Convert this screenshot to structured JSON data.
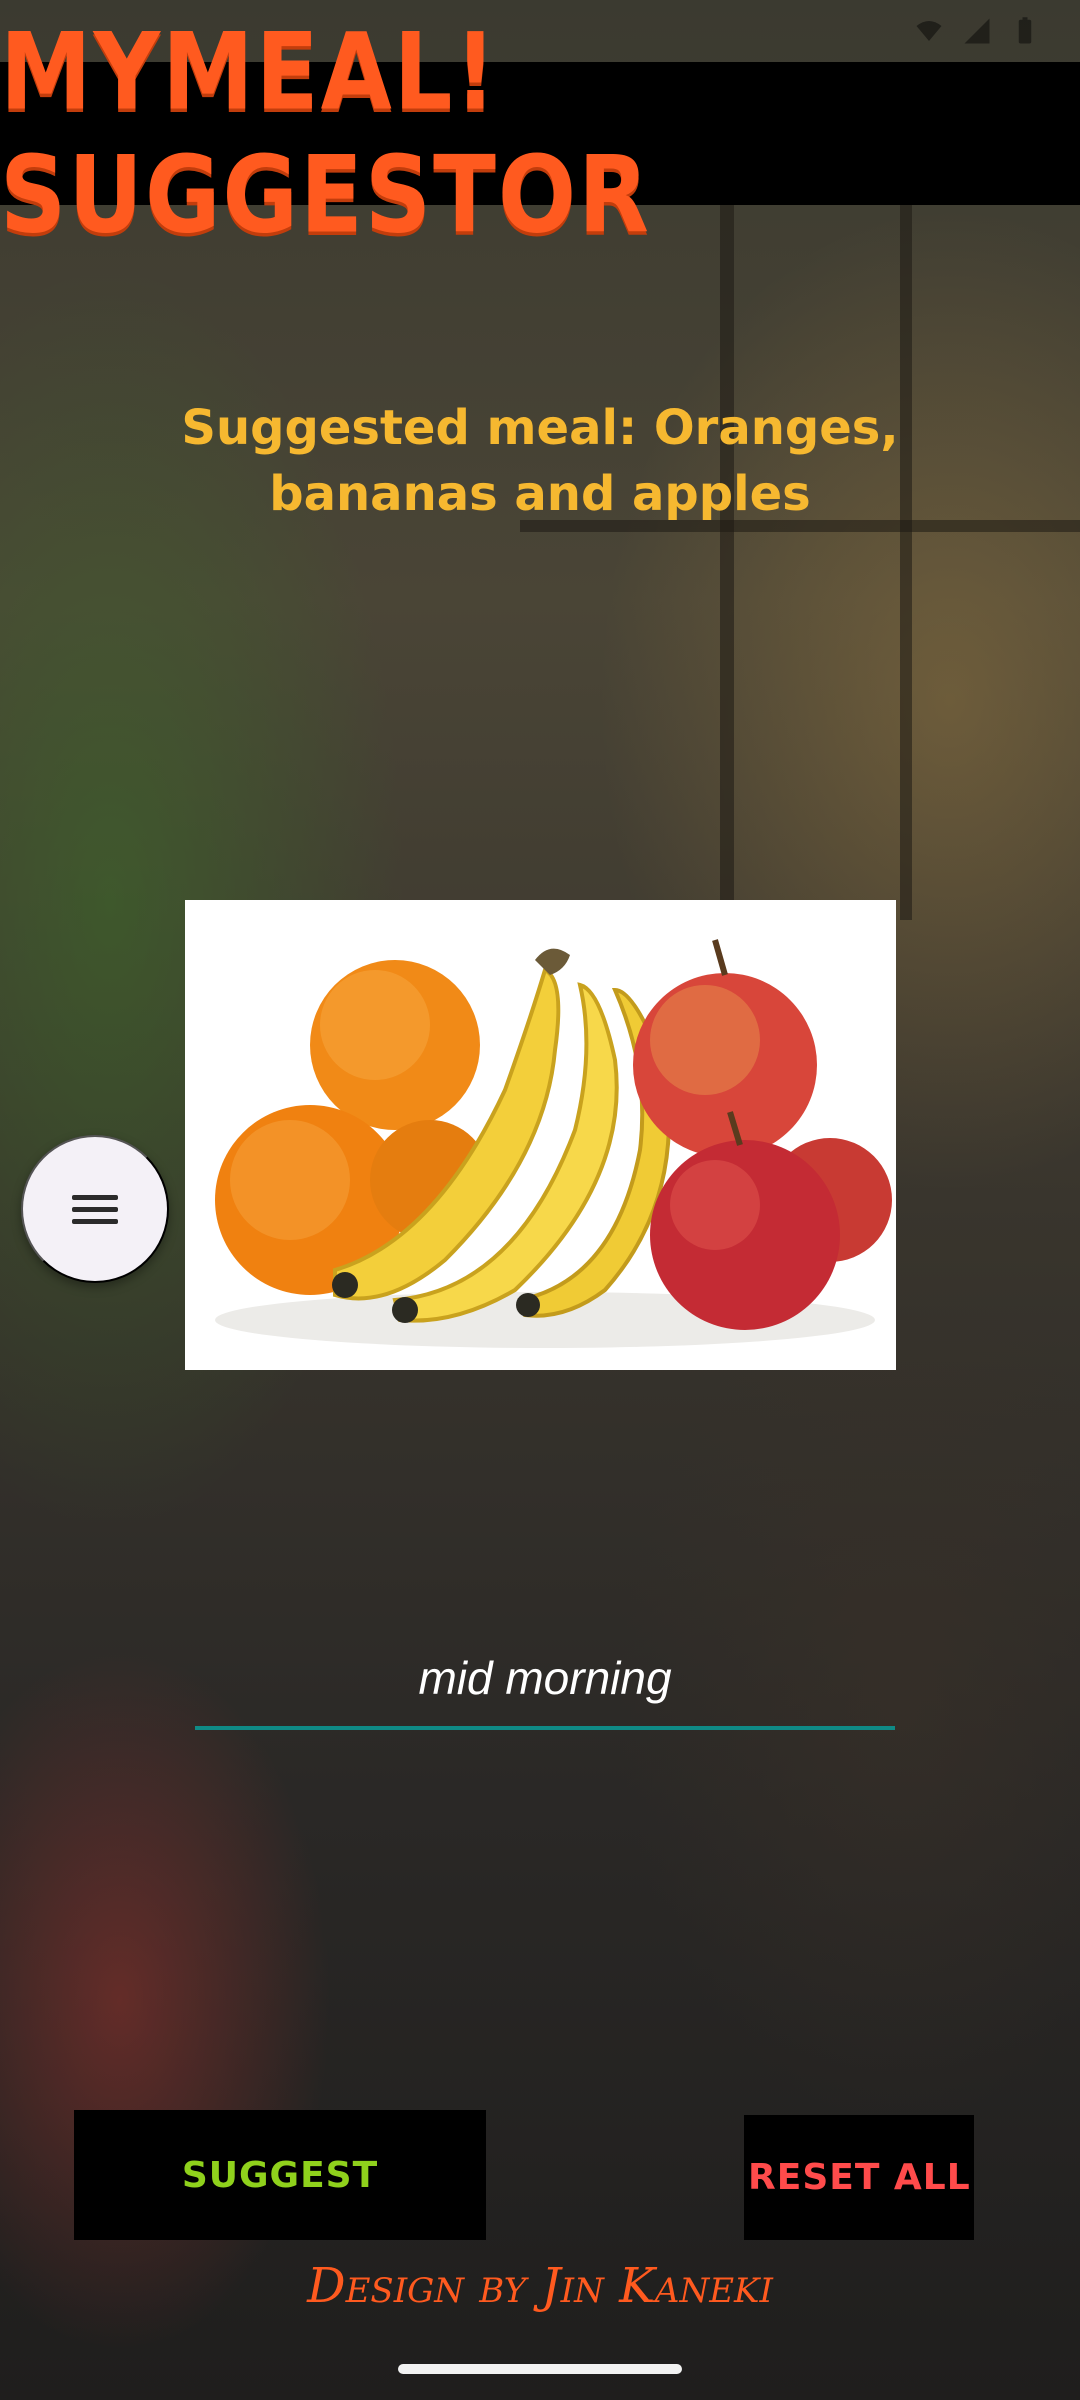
{
  "app": {
    "title": "MYMEAL! SUGGESTOR"
  },
  "suggestion": {
    "text": "Suggested meal: Oranges, bananas and apples"
  },
  "meal_image": {
    "depicts": [
      "oranges",
      "bananas",
      "apples"
    ]
  },
  "menu_fab": {
    "icon": "hamburger-menu-icon"
  },
  "meal_input": {
    "value": "mid morning",
    "accent_color": "#0f8a86"
  },
  "buttons": {
    "suggest_label": "SUGGEST",
    "reset_label": "RESET ALL"
  },
  "footer": {
    "credit": "Design by Jin Kaneki"
  },
  "colors": {
    "title": "#ff5a1f",
    "suggestion": "#f6b830",
    "suggest_button_text": "#8fd11c",
    "reset_button_text": "#ff4b4b"
  }
}
